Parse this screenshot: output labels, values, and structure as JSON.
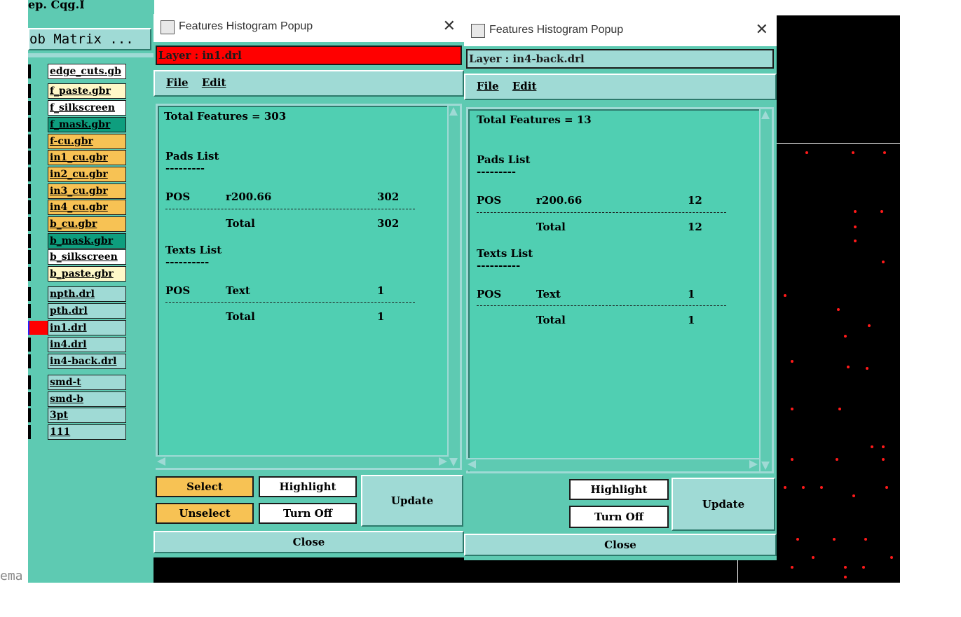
{
  "left_panel": {
    "top_fragment": "ep. Cqg.I",
    "job_matrix": "ob Matrix ...",
    "bottom_fragment": "ema",
    "layers": [
      {
        "label": "edge_cuts.gb",
        "bg": "#ffffff"
      },
      {
        "label": "f_paste.gbr",
        "bg": "#fff8c8"
      },
      {
        "label": "f_silkscreen",
        "bg": "#ffffff"
      },
      {
        "label": "f_mask.gbr",
        "bg": "#0e9e7e"
      },
      {
        "label": "f-cu.gbr",
        "bg": "#f7c254"
      },
      {
        "label": "in1_cu.gbr",
        "bg": "#f7c254"
      },
      {
        "label": "in2_cu.gbr",
        "bg": "#f7c254"
      },
      {
        "label": "in3_cu.gbr",
        "bg": "#f7c254"
      },
      {
        "label": "in4_cu.gbr",
        "bg": "#f7c254"
      },
      {
        "label": "b_cu.gbr",
        "bg": "#f7c254"
      },
      {
        "label": "b_mask.gbr",
        "bg": "#0e9e7e"
      },
      {
        "label": "b_silkscreen",
        "bg": "#ffffff"
      },
      {
        "label": "b_paste.gbr",
        "bg": "#fff8c8"
      },
      {
        "label": "npth.drl",
        "bg": "#9fdad5"
      },
      {
        "label": "pth.drl",
        "bg": "#9fdad5"
      },
      {
        "label": "in1.drl",
        "bg": "#9fdad5"
      },
      {
        "label": "in4.drl",
        "bg": "#9fdad5"
      },
      {
        "label": "in4-back.drl",
        "bg": "#9fdad5"
      },
      {
        "label": "smd-t",
        "bg": "#9fdad5"
      },
      {
        "label": "smd-b",
        "bg": "#9fdad5"
      },
      {
        "label": "3pt",
        "bg": "#9fdad5"
      },
      {
        "label": "111",
        "bg": "#9fdad5"
      }
    ]
  },
  "window1": {
    "title": "Features Histogram Popup",
    "layer": "Layer :  in1.drl",
    "menu": {
      "file": "File",
      "edit": "Edit"
    },
    "total": "Total Features = 303",
    "pads_header": "Pads List",
    "pads_rule": "---------",
    "pad_row": {
      "type": "POS",
      "sym": "r200.66",
      "count": "302"
    },
    "pad_total": {
      "label": "Total",
      "count": "302"
    },
    "texts_header": "Texts List",
    "texts_rule": "----------",
    "text_row": {
      "type": "POS",
      "sym": "Text",
      "count": "1"
    },
    "text_total": {
      "label": "Total",
      "count": "1"
    },
    "buttons": {
      "select": "Select",
      "unselect": "Unselect",
      "highlight": "Highlight",
      "turn_off": "Turn Off",
      "update": "Update",
      "close": "Close"
    }
  },
  "window2": {
    "title": "Features Histogram Popup",
    "layer": "Layer :  in4-back.drl",
    "menu": {
      "file": "File",
      "edit": "Edit"
    },
    "total": "Total Features = 13",
    "pads_header": "Pads List",
    "pads_rule": "---------",
    "pad_row": {
      "type": "POS",
      "sym": "r200.66",
      "count": "12"
    },
    "pad_total": {
      "label": "Total",
      "count": "12"
    },
    "texts_header": "Texts List",
    "texts_rule": "----------",
    "text_row": {
      "type": "POS",
      "sym": "Text",
      "count": "1"
    },
    "text_total": {
      "label": "Total",
      "count": "1"
    },
    "buttons": {
      "highlight": "Highlight",
      "turn_off": "Turn Off",
      "update": "Update",
      "close": "Close"
    }
  },
  "colors": {
    "panel": "#5ecab2",
    "highlight": "#ff0000",
    "canvas": "#000000",
    "drill": "#ff1a1a"
  }
}
